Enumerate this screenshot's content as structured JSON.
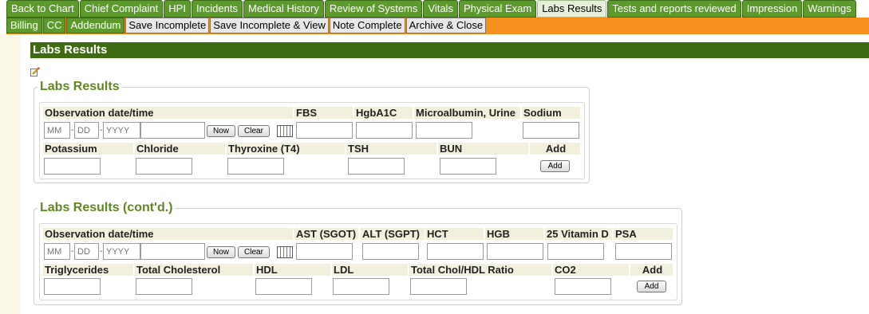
{
  "nav": {
    "tabs": [
      "Back to Chart",
      "Chief Complaint",
      "HPI",
      "Incidents",
      "Medical History",
      "Review of Systems",
      "Vitals",
      "Physical Exam",
      "Labs Results",
      "Tests and reports reviewed",
      "Impression",
      "Warnings"
    ],
    "active_tab": "Labs Results",
    "subtabs": [
      "Billing",
      "CC",
      "Addendum"
    ],
    "actions": [
      "Save Incomplete",
      "Save Incomplete & View",
      "Note Complete",
      "Archive & Close"
    ]
  },
  "page_title": "Labs Results",
  "colors": {
    "tab_green": "#5c9a2c",
    "title_bar": "#3f6b12",
    "orange_bar": "#f5901e",
    "legend_text": "#5c8a1e"
  },
  "date_placeholders": {
    "month": "MM",
    "day": "DD",
    "year": "YYYY"
  },
  "buttons": {
    "now": "Now",
    "clear": "Clear",
    "add": "Add"
  },
  "section1": {
    "legend": "Labs Results",
    "obs_label": "Observation date/time",
    "row1_fields": [
      "FBS",
      "HgbA1C",
      "Microalbumin, Urine",
      "Sodium"
    ],
    "row2_fields": [
      "Potassium",
      "Chloride",
      "Thyroxine (T4)",
      "TSH",
      "BUN"
    ],
    "add_label": "Add"
  },
  "section2": {
    "legend": "Labs Results (cont'd.)",
    "obs_label": "Observation date/time",
    "row1_fields": [
      "AST (SGOT)",
      "ALT (SGPT)",
      "HCT",
      "HGB",
      "25 Vitamin D",
      "PSA"
    ],
    "row2_fields": [
      "Triglycerides",
      "Total Cholesterol",
      "HDL",
      "LDL",
      "Total Chol/HDL Ratio",
      "CO2"
    ],
    "add_label": "Add"
  }
}
